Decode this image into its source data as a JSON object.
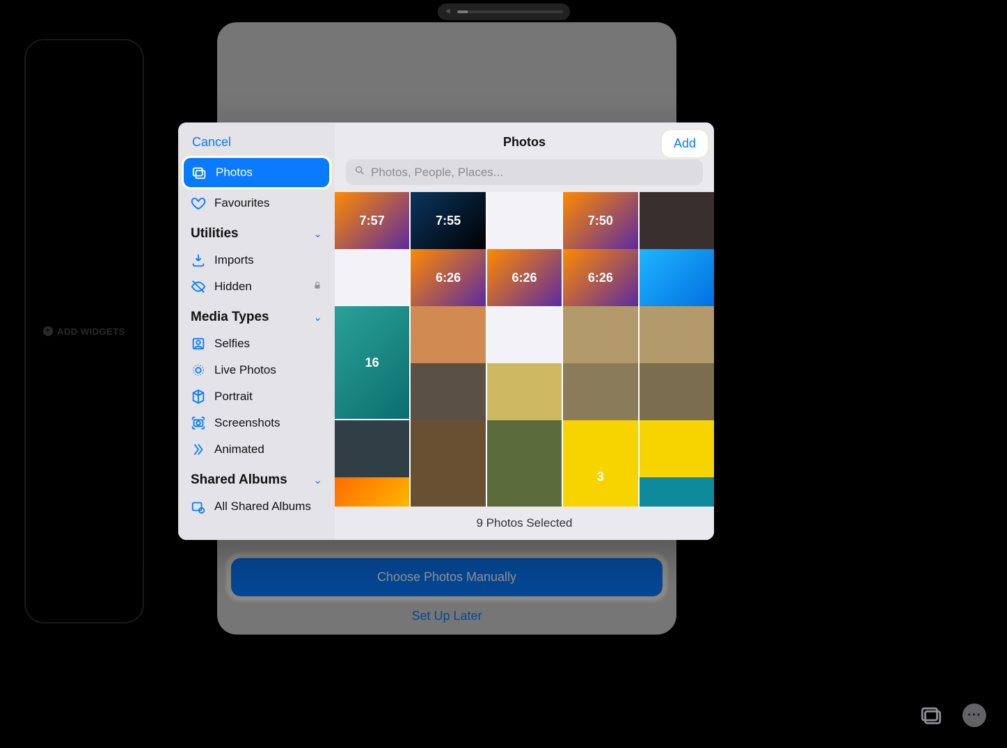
{
  "volume": {
    "fill_percent": 10
  },
  "widget_panel": {
    "add_label": "ADD WIDGETS"
  },
  "wallpaper_prompt": {
    "choose_label": "Choose Photos Manually",
    "later_label": "Set Up Later"
  },
  "picker": {
    "cancel": "Cancel",
    "title": "Photos",
    "add": "Add",
    "search_placeholder": "Photos, People, Places...",
    "selected_text": "9 Photos Selected"
  },
  "sidebar": {
    "items": [
      {
        "icon": "photos-icon",
        "label": "Photos",
        "active": true
      },
      {
        "icon": "heart-icon",
        "label": "Favourites"
      }
    ],
    "sections": [
      {
        "title": "Utilities",
        "items": [
          {
            "icon": "import-icon",
            "label": "Imports"
          },
          {
            "icon": "hidden-icon",
            "label": "Hidden",
            "locked": true
          }
        ]
      },
      {
        "title": "Media Types",
        "items": [
          {
            "icon": "selfie-icon",
            "label": "Selfies"
          },
          {
            "icon": "livephoto-icon",
            "label": "Live Photos"
          },
          {
            "icon": "cube-icon",
            "label": "Portrait"
          },
          {
            "icon": "screenshot-icon",
            "label": "Screenshots"
          },
          {
            "icon": "animated-icon",
            "label": "Animated"
          }
        ]
      },
      {
        "title": "Shared Albums",
        "items": [
          {
            "icon": "shared-icon",
            "label": "All Shared Albums"
          }
        ]
      }
    ]
  },
  "grid_thumbs": [
    {
      "bg": "linear-gradient(135deg,#ff8a00,#5b2aa1)",
      "text": "7:57"
    },
    {
      "bg": "linear-gradient(135deg,#0a3560,#000)",
      "text": "7:55"
    },
    {
      "bg": "#f2f2f7",
      "text": ""
    },
    {
      "bg": "linear-gradient(135deg,#ff8a00,#5b2aa1)",
      "text": "7:50"
    },
    {
      "bg": "#3a2f2f",
      "text": ""
    },
    {
      "bg": "#f2f2f7",
      "text": ""
    },
    {
      "bg": "linear-gradient(135deg,#ff8a00,#5b2aa1)",
      "text": "6:26"
    },
    {
      "bg": "linear-gradient(135deg,#ff8a00,#5b2aa1)",
      "text": "6:26"
    },
    {
      "bg": "linear-gradient(135deg,#ff8a00,#5b2aa1)",
      "text": "6:26"
    },
    {
      "bg": "linear-gradient(135deg,#1fb5ff,#0070e0)",
      "text": ""
    },
    {
      "bg": "linear-gradient(135deg,#2aa198,#0b6e6e)",
      "text": "16",
      "tall": true
    },
    {
      "bg": "#d08a52",
      "text": ""
    },
    {
      "bg": "#f2f2f7",
      "text": ""
    },
    {
      "bg": "#b39a6a",
      "text": ""
    },
    {
      "bg": "#b39a6a",
      "text": ""
    },
    {
      "bg": "#5b5044",
      "text": ""
    },
    {
      "bg": "#cfb960",
      "text": ""
    },
    {
      "bg": "#8a7c5a",
      "text": ""
    },
    {
      "bg": "#7a6e4e",
      "text": ""
    },
    {
      "bg": "#303e46",
      "text": ""
    },
    {
      "bg": "#6a5032",
      "text": "",
      "tall": true
    },
    {
      "bg": "#5a6a3a",
      "text": "",
      "tall": true
    },
    {
      "bg": "#f7d400",
      "text": "3",
      "tall": true
    },
    {
      "bg": "#f7d400",
      "text": ""
    },
    {
      "bg": "linear-gradient(135deg,#ff6a00,#ffcc00)",
      "text": "",
      "selected": true
    },
    {
      "bg": "#0d8a9c",
      "text": ""
    },
    {
      "bg": "#ffffff",
      "text": "",
      "empty": true
    },
    {
      "bg": "#ffffff",
      "text": "",
      "empty": true
    },
    {
      "bg": "#ffffff",
      "text": "",
      "empty": true
    }
  ]
}
